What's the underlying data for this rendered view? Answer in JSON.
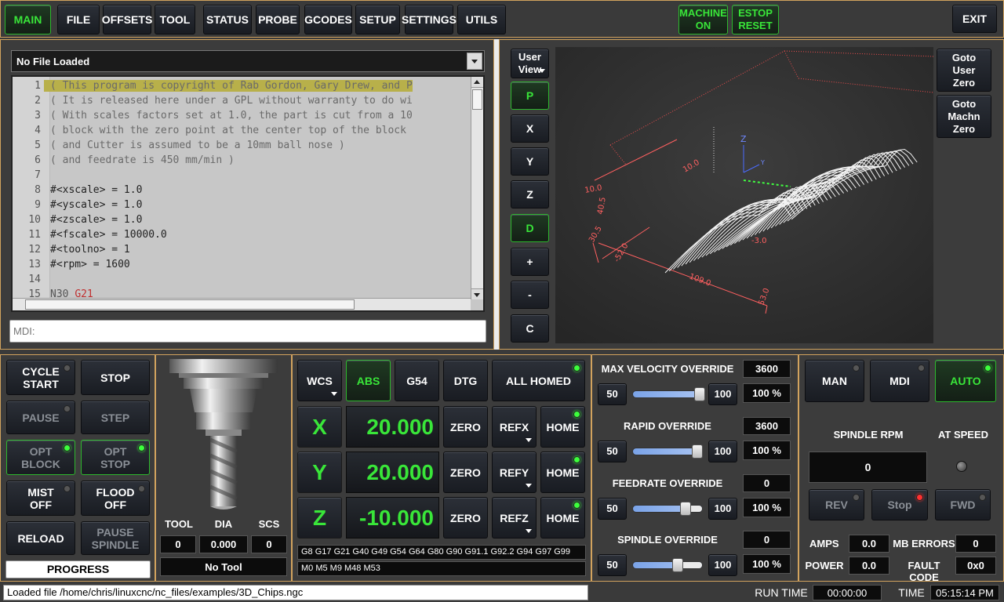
{
  "topnav": {
    "tabs": [
      "MAIN",
      "FILE",
      "OFFSETS",
      "TOOL",
      "STATUS",
      "PROBE",
      "GCODES",
      "SETUP",
      "SETTINGS",
      "UTILS"
    ],
    "machine": "MACHINE ON",
    "estop": "ESTOP RESET",
    "exit": "EXIT"
  },
  "editor": {
    "file_select": "No File Loaded",
    "lines": [
      {
        "n": "1",
        "t": "( This program is copyright of Rab Gordon, Gary Drew, and P"
      },
      {
        "n": "2",
        "t": "( It is released here under a GPL without warranty to do wi"
      },
      {
        "n": "3",
        "t": "( With scales factors set at 1.0, the part is cut from a 10"
      },
      {
        "n": "4",
        "t": "( block with the zero point at the center top of the block"
      },
      {
        "n": "5",
        "t": "( and Cutter is assumed to be a 10mm ball nose )"
      },
      {
        "n": "6",
        "t": "( and feedrate is 450 mm/min )"
      },
      {
        "n": "7",
        "t": ""
      },
      {
        "n": "8",
        "t": "#<xscale> = 1.0"
      },
      {
        "n": "9",
        "t": "#<yscale> = 1.0"
      },
      {
        "n": "10",
        "t": "#<zscale> = 1.0"
      },
      {
        "n": "11",
        "t": "#<fscale> = 10000.0"
      },
      {
        "n": "12",
        "t": "#<toolno> = 1"
      },
      {
        "n": "13",
        "t": "#<rpm>    = 1600"
      },
      {
        "n": "14",
        "t": ""
      },
      {
        "n": "15",
        "t": "N30 ",
        "t2": "G21"
      }
    ],
    "mdi_placeholder": "MDI:"
  },
  "view": {
    "user_view": "User View",
    "side_buttons": [
      "P",
      "X",
      "Y",
      "Z",
      "D",
      "+",
      "-",
      "C"
    ],
    "goto_user_zero": "Goto User Zero",
    "goto_machn_zero": "Goto Machn Zero",
    "dims": [
      "10.0",
      "40.5",
      "30.5",
      "-52.0",
      "109.0",
      "53.0",
      "-3.0",
      "10.0"
    ],
    "axis_z": "Z",
    "axis_y": "Y"
  },
  "cycle": {
    "cycle_start": "CYCLE START",
    "stop": "STOP",
    "pause": "PAUSE",
    "step": "STEP",
    "opt_block": "OPT BLOCK",
    "opt_stop": "OPT STOP",
    "mist": "MIST OFF",
    "flood": "FLOOD OFF",
    "reload": "RELOAD",
    "pause_spindle": "PAUSE SPINDLE",
    "progress": "PROGRESS"
  },
  "tool": {
    "tool_label": "TOOL",
    "dia_label": "DIA",
    "scs_label": "SCS",
    "tool": "0",
    "dia": "0.000",
    "scs": "0",
    "name": "No Tool"
  },
  "dro": {
    "wcs": "WCS",
    "abs": "ABS",
    "g54": "G54",
    "dtg": "DTG",
    "all_homed": "ALL HOMED",
    "axes": [
      {
        "axis": "X",
        "value": "20.000",
        "ref": "REFX"
      },
      {
        "axis": "Y",
        "value": "20.000",
        "ref": "REFY"
      },
      {
        "axis": "Z",
        "value": "-10.000",
        "ref": "REFZ"
      }
    ],
    "zero": "ZERO",
    "home": "HOME",
    "gcodes": "G8 G17 G21 G40 G49 G54 G64 G80 G90 G91.1 G92.2 G94 G97 G99",
    "mcodes": "M0 M5 M9 M48 M53"
  },
  "overrides": [
    {
      "title": "MAX VELOCITY OVERRIDE",
      "value": "3600",
      "min": "50",
      "max": "100",
      "pct": "100 %",
      "level": 1.0
    },
    {
      "title": "RAPID OVERRIDE",
      "value": "3600",
      "min": "50",
      "max": "100",
      "pct": "100 %",
      "level": 0.97
    },
    {
      "title": "FEEDRATE OVERRIDE",
      "value": "0",
      "min": "50",
      "max": "100",
      "pct": "100 %",
      "level": 0.8
    },
    {
      "title": "SPINDLE OVERRIDE",
      "value": "0",
      "min": "50",
      "max": "100",
      "pct": "100 %",
      "level": 0.68
    }
  ],
  "spindle": {
    "man": "MAN",
    "mdi": "MDI",
    "auto": "AUTO",
    "rpm_label": "SPINDLE RPM",
    "at_speed": "AT SPEED",
    "rpm": "0",
    "rev": "REV",
    "stop": "Stop",
    "fwd": "FWD",
    "amps_label": "AMPS",
    "amps": "0.0",
    "mb_label": "MB ERRORS",
    "mb": "0",
    "power_label": "POWER",
    "power": "0.0",
    "fault_label": "FAULT CODE",
    "fault": "0x0"
  },
  "status": {
    "message": "Loaded file /home/chris/linuxcnc/nc_files/examples/3D_Chips.ngc",
    "run_time_label": "RUN TIME",
    "run_time": "00:00:00",
    "time_label": "TIME",
    "time": "05:15:14 PM"
  },
  "colors": {
    "accent": "#d2a35e",
    "active_green": "#39e639",
    "highlight": "#b8b04a"
  }
}
